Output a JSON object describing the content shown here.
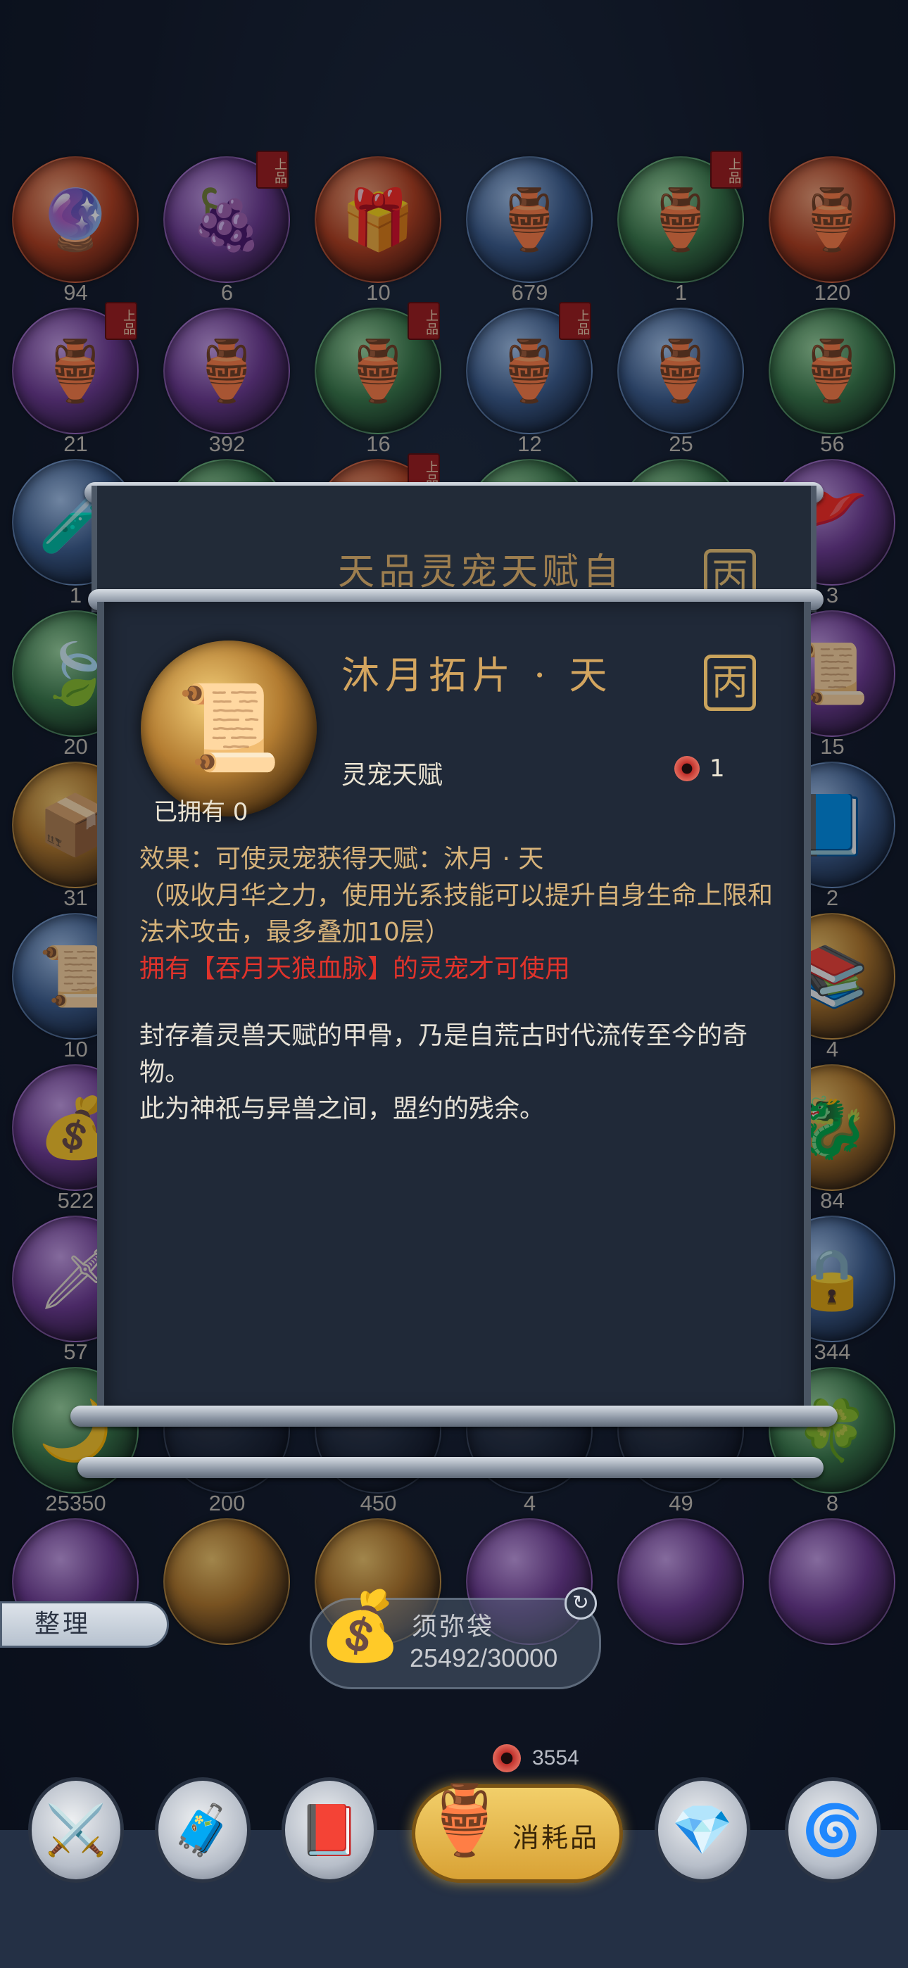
{
  "inventory": {
    "items": [
      {
        "icon": "🔮",
        "style": "red",
        "count": "94",
        "badge": ""
      },
      {
        "icon": "🍇",
        "style": "purple",
        "count": "6",
        "badge": "上品"
      },
      {
        "icon": "🎁",
        "style": "red",
        "count": "10",
        "badge": ""
      },
      {
        "icon": "🏺",
        "style": "blue",
        "count": "679",
        "badge": ""
      },
      {
        "icon": "🏺",
        "style": "green",
        "count": "1",
        "badge": "上品"
      },
      {
        "icon": "🏺",
        "style": "red",
        "count": "120",
        "badge": ""
      },
      {
        "icon": "🏺",
        "style": "purple",
        "count": "21",
        "badge": "上品"
      },
      {
        "icon": "🏺",
        "style": "purple",
        "count": "392",
        "badge": ""
      },
      {
        "icon": "🏺",
        "style": "green",
        "count": "16",
        "badge": "上品"
      },
      {
        "icon": "🏺",
        "style": "blue",
        "count": "12",
        "badge": "上品"
      },
      {
        "icon": "🏺",
        "style": "blue",
        "count": "25",
        "badge": ""
      },
      {
        "icon": "🏺",
        "style": "green",
        "count": "56",
        "badge": ""
      },
      {
        "icon": "🧪",
        "style": "blue",
        "count": "1",
        "badge": ""
      },
      {
        "icon": "",
        "style": "green",
        "count": "",
        "badge": ""
      },
      {
        "icon": "",
        "style": "red",
        "count": "",
        "badge": "上品"
      },
      {
        "icon": "",
        "style": "green",
        "count": "",
        "badge": ""
      },
      {
        "icon": "",
        "style": "green",
        "count": "",
        "badge": ""
      },
      {
        "icon": "🚩",
        "style": "purple",
        "count": "3",
        "badge": ""
      },
      {
        "icon": "🍃",
        "style": "green",
        "count": "20",
        "badge": ""
      },
      {
        "icon": "",
        "style": "none",
        "count": "",
        "badge": ""
      },
      {
        "icon": "",
        "style": "none",
        "count": "",
        "badge": ""
      },
      {
        "icon": "",
        "style": "none",
        "count": "",
        "badge": ""
      },
      {
        "icon": "",
        "style": "none",
        "count": "",
        "badge": ""
      },
      {
        "icon": "📜",
        "style": "purple",
        "count": "15",
        "badge": ""
      },
      {
        "icon": "📦",
        "style": "gold",
        "count": "31",
        "badge": ""
      },
      {
        "icon": "",
        "style": "none",
        "count": "",
        "badge": ""
      },
      {
        "icon": "",
        "style": "none",
        "count": "",
        "badge": ""
      },
      {
        "icon": "",
        "style": "none",
        "count": "",
        "badge": ""
      },
      {
        "icon": "",
        "style": "none",
        "count": "",
        "badge": ""
      },
      {
        "icon": "📘",
        "style": "blue",
        "count": "2",
        "badge": ""
      },
      {
        "icon": "📜",
        "style": "blue",
        "count": "10",
        "badge": ""
      },
      {
        "icon": "",
        "style": "none",
        "count": "",
        "badge": ""
      },
      {
        "icon": "",
        "style": "none",
        "count": "",
        "badge": ""
      },
      {
        "icon": "",
        "style": "none",
        "count": "",
        "badge": ""
      },
      {
        "icon": "",
        "style": "none",
        "count": "",
        "badge": ""
      },
      {
        "icon": "📚",
        "style": "gold",
        "count": "4",
        "badge": ""
      },
      {
        "icon": "💰",
        "style": "purple",
        "count": "522",
        "badge": ""
      },
      {
        "icon": "",
        "style": "none",
        "count": "",
        "badge": ""
      },
      {
        "icon": "",
        "style": "none",
        "count": "",
        "badge": ""
      },
      {
        "icon": "",
        "style": "none",
        "count": "",
        "badge": ""
      },
      {
        "icon": "",
        "style": "none",
        "count": "",
        "badge": ""
      },
      {
        "icon": "🐉",
        "style": "gold",
        "count": "84",
        "badge": ""
      },
      {
        "icon": "🗡",
        "style": "purple",
        "count": "57",
        "badge": ""
      },
      {
        "icon": "",
        "style": "none",
        "count": "",
        "badge": ""
      },
      {
        "icon": "",
        "style": "none",
        "count": "",
        "badge": ""
      },
      {
        "icon": "",
        "style": "none",
        "count": "",
        "badge": ""
      },
      {
        "icon": "",
        "style": "none",
        "count": "",
        "badge": ""
      },
      {
        "icon": "🔒",
        "style": "blue",
        "count": "344",
        "badge": ""
      },
      {
        "icon": "🌙",
        "style": "green",
        "count": "25350",
        "badge": ""
      },
      {
        "icon": "",
        "style": "none",
        "count": "200",
        "badge": ""
      },
      {
        "icon": "",
        "style": "none",
        "count": "450",
        "badge": ""
      },
      {
        "icon": "",
        "style": "none",
        "count": "4",
        "badge": ""
      },
      {
        "icon": "",
        "style": "none",
        "count": "49",
        "badge": ""
      },
      {
        "icon": "🍀",
        "style": "green",
        "count": "8",
        "badge": ""
      },
      {
        "icon": "",
        "style": "purple",
        "count": "",
        "badge": ""
      },
      {
        "icon": "",
        "style": "gold",
        "count": "",
        "badge": ""
      },
      {
        "icon": "",
        "style": "gold",
        "count": "",
        "badge": ""
      },
      {
        "icon": "",
        "style": "purple",
        "count": "",
        "badge": ""
      },
      {
        "icon": "",
        "style": "purple",
        "count": "",
        "badge": ""
      },
      {
        "icon": "",
        "style": "purple",
        "count": "",
        "badge": ""
      }
    ]
  },
  "back_scroll": {
    "title": "天品灵宠天赋自",
    "seal": "丙"
  },
  "detail": {
    "icon": "📜",
    "name": "沐月拓片 · 天",
    "seal": "丙",
    "type": "灵宠天赋",
    "cost_value": "1",
    "owned": "已拥有 0",
    "effect_line1": "效果：可使灵宠获得天赋：沐月 · 天",
    "effect_line2": "（吸收月华之力，使用光系技能可以提升自身生命上限和法术攻击，最多叠加10层）",
    "requirement": "拥有【吞月天狼血脉】的灵宠才可使用",
    "lore_line1": "封存着灵兽天赋的甲骨，乃是自荒古时代流传至今的奇物。",
    "lore_line2": "此为神祇与异兽之间，盟约的残余。"
  },
  "toolbar": {
    "sort_label": "整理",
    "bag_name": "须弥袋",
    "bag_capacity": "25492/30000",
    "currency_value": "3554"
  },
  "tabs": {
    "active_label": "消耗品",
    "icons": [
      "⚔️",
      "🧳",
      "📕",
      "💎",
      "🌀"
    ]
  }
}
